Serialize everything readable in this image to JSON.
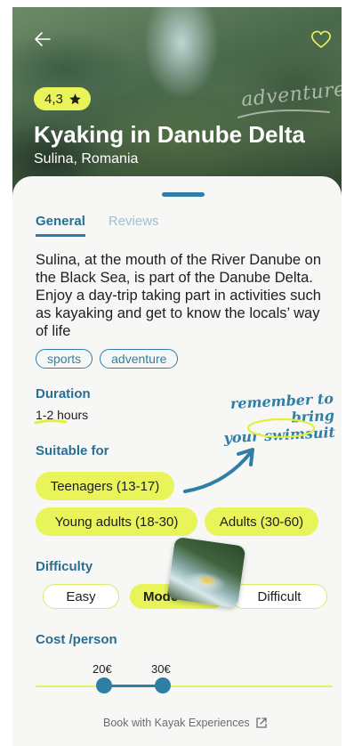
{
  "hero": {
    "rating": "4,3",
    "title": "Kyaking in Danube Delta",
    "location": "Sulina, Romania",
    "sticker": "adventure"
  },
  "tabs": [
    {
      "label": "General",
      "active": true
    },
    {
      "label": "Reviews",
      "active": false
    }
  ],
  "description": "Sulina, at the mouth of the River Danube on the Black Sea, is part of the Danube Delta. Enjoy a day-trip taking part in activities such as kayaking and get to know the locals’ way of life",
  "tags": [
    "sports",
    "adventure"
  ],
  "duration": {
    "title": "Duration",
    "value": "1-2 hours"
  },
  "note": {
    "line1": "remember to bring",
    "line2": "your swimsuit"
  },
  "suitable": {
    "title": "Suitable for",
    "options": [
      "Teenagers (13-17)",
      "Young adults (18-30)",
      "Adults (30-60)"
    ]
  },
  "difficulty": {
    "title": "Difficulty",
    "options": [
      "Easy",
      "Mode",
      "Difficult"
    ],
    "selected": "Mode"
  },
  "cost": {
    "title": "Cost /person",
    "min_label": "20€",
    "max_label": "30€",
    "min": 20,
    "max": 30
  },
  "book_link": "Book with Kayak Experiences",
  "colors": {
    "accent": "#2f7ea5",
    "highlight": "#e8f45a",
    "background": "#f7f8f6"
  },
  "icons": [
    "arrow-left-icon",
    "heart-icon",
    "star-icon",
    "external-link-icon"
  ]
}
